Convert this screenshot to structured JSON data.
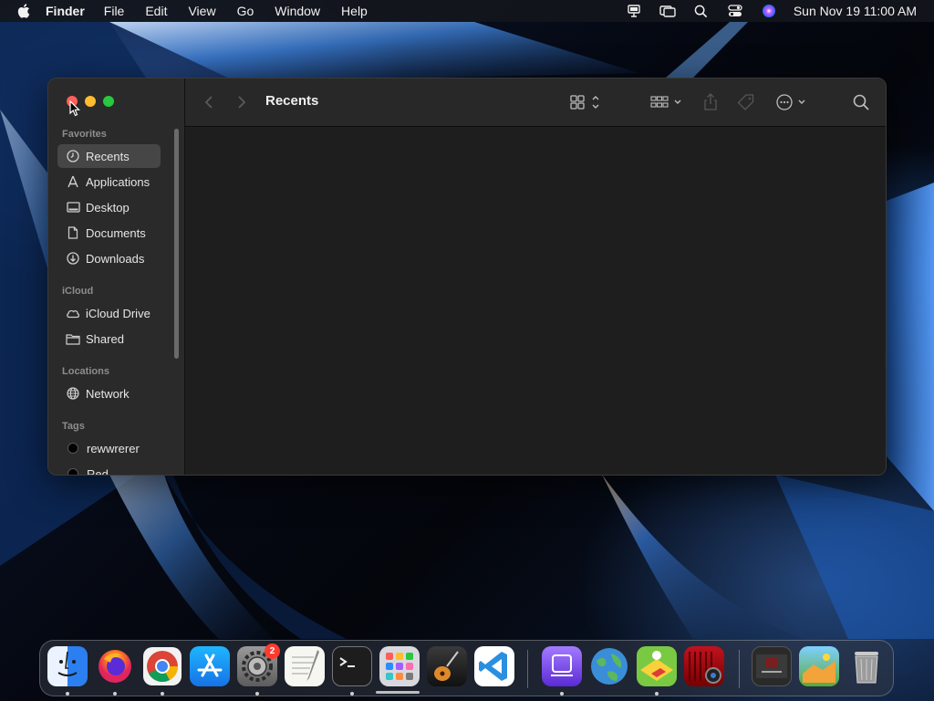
{
  "menubar": {
    "app_name": "Finder",
    "items": [
      "File",
      "Edit",
      "View",
      "Go",
      "Window",
      "Help"
    ],
    "status_icons": [
      "presenter-icon",
      "screen-mirror-icon",
      "spotlight-icon",
      "control-center-icon",
      "siri-icon"
    ],
    "clock": "Sun Nov 19  11:00 AM"
  },
  "window": {
    "title": "Recents",
    "sidebar": {
      "favorites_label": "Favorites",
      "favorites": [
        {
          "label": "Recents",
          "icon": "clock-icon",
          "selected": true
        },
        {
          "label": "Applications",
          "icon": "applications-icon"
        },
        {
          "label": "Desktop",
          "icon": "desktop-icon"
        },
        {
          "label": "Documents",
          "icon": "document-icon"
        },
        {
          "label": "Downloads",
          "icon": "download-icon"
        }
      ],
      "icloud_label": "iCloud",
      "icloud": [
        {
          "label": "iCloud Drive",
          "icon": "cloud-icon"
        },
        {
          "label": "Shared",
          "icon": "shared-folder-icon"
        }
      ],
      "locations_label": "Locations",
      "locations": [
        {
          "label": "Network",
          "icon": "globe-icon"
        }
      ],
      "tags_label": "Tags",
      "tags": [
        {
          "label": "rewwrerer",
          "color": "#000000"
        },
        {
          "label": "Red",
          "color": "#000000"
        }
      ]
    },
    "toolbar": {
      "icons": [
        "back-icon",
        "forward-icon",
        "view-grid-icon",
        "group-icon",
        "share-icon",
        "tag-icon",
        "more-icon",
        "search-icon"
      ]
    }
  },
  "dock": {
    "apps": [
      {
        "name": "Finder",
        "icon": "finder-icon",
        "running": true
      },
      {
        "name": "Firefox",
        "icon": "firefox-icon",
        "running": true
      },
      {
        "name": "Chrome",
        "icon": "chrome-icon",
        "running": true
      },
      {
        "name": "App Store",
        "icon": "app-store-icon",
        "running": false
      },
      {
        "name": "System Settings",
        "icon": "settings-icon",
        "running": true,
        "badge": "2"
      },
      {
        "name": "TextEdit",
        "icon": "textedit-icon",
        "running": false
      },
      {
        "name": "Terminal",
        "icon": "terminal-icon",
        "running": true
      },
      {
        "name": "Launchpad",
        "icon": "launchpad-icon",
        "running": false
      },
      {
        "name": "GarageBand",
        "icon": "garageband-icon",
        "running": false
      },
      {
        "name": "VS Code",
        "icon": "vscode-icon",
        "running": false
      },
      {
        "name": "Apple Configurator",
        "icon": "configurator-icon",
        "running": true
      },
      {
        "name": "Earth",
        "icon": "earth-icon",
        "running": false
      },
      {
        "name": "Game",
        "icon": "game-icon",
        "running": true
      },
      {
        "name": "Photo Booth",
        "icon": "photobooth-icon",
        "running": false
      },
      {
        "name": "Hand Mirror",
        "icon": "window-thumb-icon",
        "running": false
      },
      {
        "name": "Game Window",
        "icon": "window-thumb-icon",
        "running": false
      },
      {
        "name": "Trash",
        "icon": "trash-icon",
        "running": false
      }
    ]
  }
}
